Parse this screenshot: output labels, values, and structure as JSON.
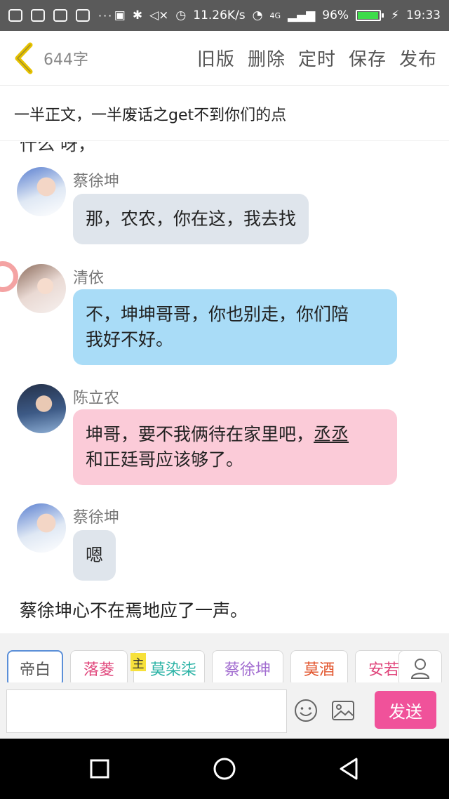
{
  "status_bar": {
    "speed": "11.26K/s",
    "network": "4G",
    "battery": "96%",
    "battery_level": 0.96,
    "time": "19:33",
    "more": "···"
  },
  "top_bar": {
    "word_count": "644字",
    "actions": [
      "旧版",
      "删除",
      "定时",
      "保存",
      "发布"
    ]
  },
  "story_title": "一半正文，一半废话之get不到你们的点",
  "chat": {
    "partial_line": "什么 呀，",
    "messages": [
      {
        "name": "蔡徐坤",
        "text": "那，农农，你在这，我去找"
      },
      {
        "name": "清依",
        "text_line1": "不，坤坤哥哥，你也别走，你们陪",
        "text_line2": "我好不好。"
      },
      {
        "name": "陈立农",
        "text_line1_a": "坤哥，要不我俩待在家里吧，",
        "text_line1_b": "丞丞",
        "text_line2": "和正廷哥应该够了。"
      },
      {
        "name": "蔡徐坤",
        "text": "嗯"
      }
    ],
    "narration": "蔡徐坤心不在焉地应了一声。"
  },
  "characters": {
    "host_tag": "主",
    "chips": [
      {
        "label": "帝白",
        "color": "#555555"
      },
      {
        "label": "落菱",
        "color": "#e0457b"
      },
      {
        "label": "莫染柒",
        "color": "#2bb3a6"
      },
      {
        "label": "蔡徐坤",
        "color": "#a26dd0"
      },
      {
        "label": "莫酒",
        "color": "#e2542c"
      },
      {
        "label": "安若",
        "color": "#e0457b"
      }
    ]
  },
  "composer": {
    "input_value": "",
    "send_label": "发送"
  },
  "icons": {
    "back": "chevron-left-icon",
    "user": "user-icon",
    "emoji": "smiley-icon",
    "image": "image-icon",
    "nav_back": "triangle-back-icon",
    "nav_home": "circle-home-icon",
    "nav_recent": "square-recent-icon"
  },
  "colors": {
    "accent_back": "#e6c200",
    "send_button": "#f0529a",
    "bubble_gray": "#dfe5ec",
    "bubble_blue": "#a9dcf7",
    "bubble_pink": "#fbcbd8"
  }
}
